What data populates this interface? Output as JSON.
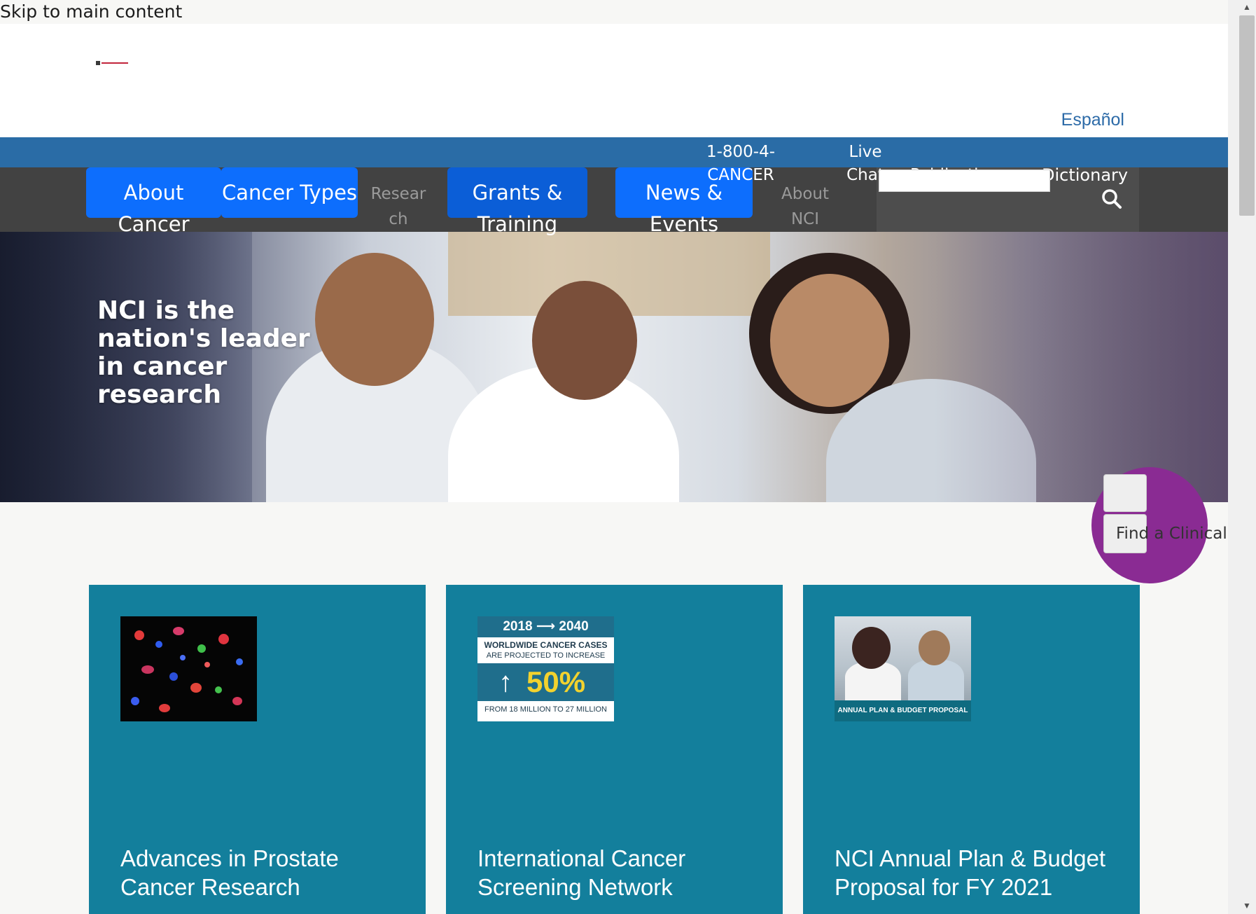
{
  "skip_link": "Skip to main content",
  "header": {
    "language_link": "Español"
  },
  "utility": {
    "phone": "1-800-4-CANCER",
    "chat": "Live Chat",
    "publications": "Publications",
    "dictionary": "Dictionary"
  },
  "nav": {
    "items": [
      {
        "label": "About Cancer"
      },
      {
        "label": "Cancer Types"
      },
      {
        "label": "Research"
      },
      {
        "label": "Grants & Training"
      },
      {
        "label": "News & Events"
      },
      {
        "label": "About NCI"
      }
    ],
    "search_placeholder": ""
  },
  "hero": {
    "title": "NCI is the nation's leader in cancer research"
  },
  "trials_button": {
    "label": "Find a Clinical Trial"
  },
  "cards": [
    {
      "title": "Advances in Prostate Cancer Research",
      "image_icon": "cell-microscopy-image"
    },
    {
      "title": "International Cancer Screening Network",
      "image_icon": "infographic-image",
      "image_text": {
        "years": "2018 ⟶ 2040",
        "line1": "WORLDWIDE CANCER CASES",
        "line2": "ARE PROJECTED TO INCREASE",
        "percent": "50%",
        "line3": "FROM 18 MILLION TO 27 MILLION"
      }
    },
    {
      "title": "NCI Annual Plan & Budget Proposal for FY 2021",
      "image_icon": "doctor-patient-photo",
      "image_caption": "ANNUAL PLAN & BUDGET PROPOSAL"
    }
  ],
  "colors": {
    "utility_bar": "#2a6ca6",
    "nav_bar": "#424242",
    "nav_active": "#0d6efd",
    "card_bg": "#137f9c",
    "trials_circle": "#8a2b93",
    "link": "#2d6ba8"
  }
}
